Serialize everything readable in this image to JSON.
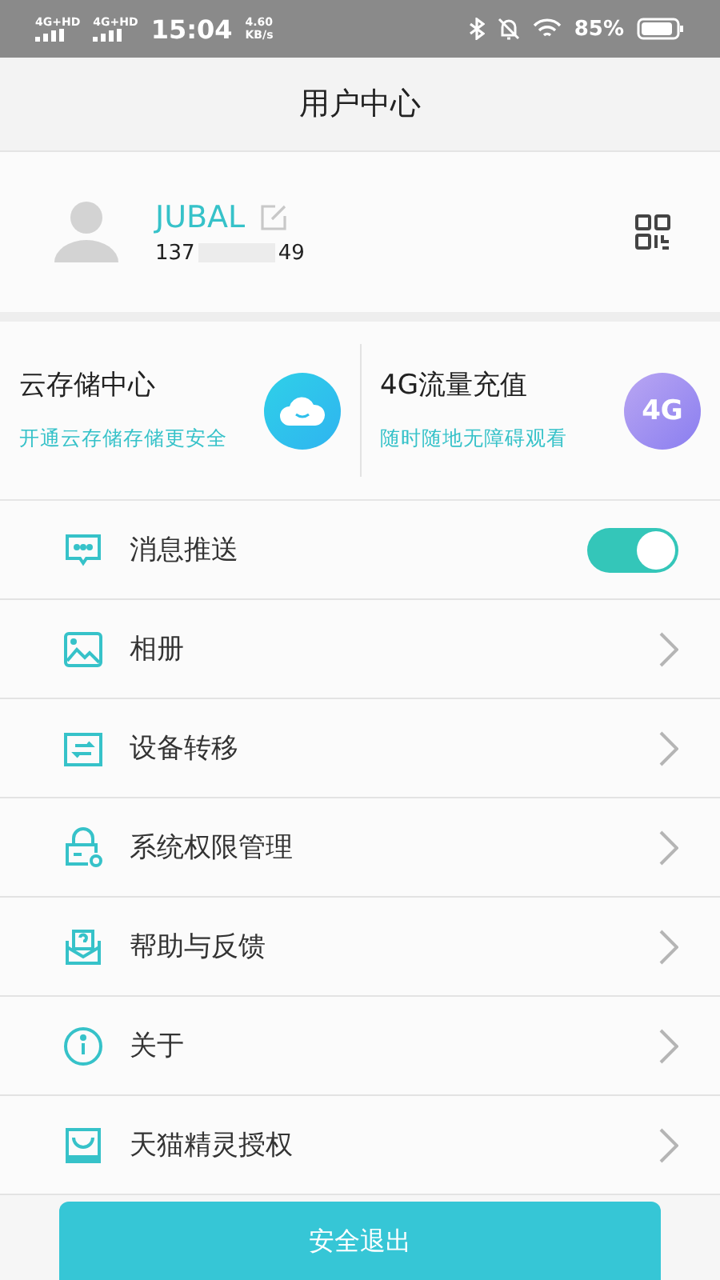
{
  "status_bar": {
    "networks": [
      "4G+HD",
      "4G+HD"
    ],
    "time": "15:04",
    "speed": [
      "4.60",
      "KB/s"
    ],
    "battery": "85%"
  },
  "header": {
    "title": "用户中心"
  },
  "profile": {
    "name": "JUBAL",
    "phone": [
      "137",
      "49"
    ]
  },
  "cards": [
    {
      "kind": "cloud",
      "title": "云存储中心",
      "subtitle": "开通云存储存储更安全"
    },
    {
      "kind": "data",
      "title": "4G流量充值",
      "subtitle": "随时随地无障碍观看",
      "badge": "4G"
    }
  ],
  "menu": [
    {
      "kind": "toggle",
      "label": "消息推送",
      "on": true
    },
    {
      "kind": "link",
      "label": "相册"
    },
    {
      "kind": "link",
      "label": "设备转移"
    },
    {
      "kind": "link",
      "label": "系统权限管理"
    },
    {
      "kind": "link",
      "label": "帮助与反馈"
    },
    {
      "kind": "link",
      "label": "关于"
    },
    {
      "kind": "link",
      "label": "天猫精灵授权"
    }
  ],
  "logout_button": "安全退出"
}
